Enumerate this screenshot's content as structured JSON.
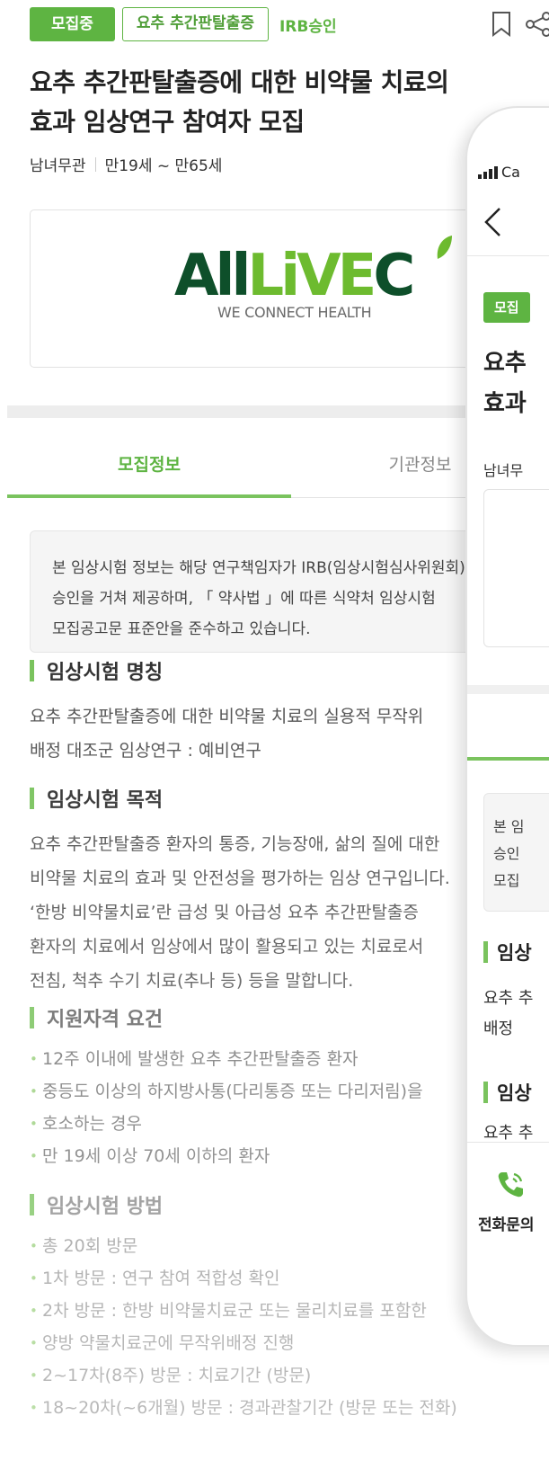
{
  "header": {
    "status_badge": "모집중",
    "category_badge": "요추 추간판탈출증",
    "irb_badge": "IRB승인",
    "title_line1": "요추 추간판탈출증에 대한 비약물 치료의",
    "title_line2": "효과 임상연구 참여자 모집",
    "gender": "남녀무관",
    "age_range": "만19세 ~ 만65세"
  },
  "logo": {
    "part1": "All",
    "part2": "LiVE",
    "part3": "C",
    "tagline": "WE CONNECT HEALTH"
  },
  "tabs": [
    {
      "label": "모집정보",
      "active": true
    },
    {
      "label": "기관정보",
      "active": false
    }
  ],
  "notice": {
    "line1": "본 임상시험 정보는 해당 연구책임자가 IRB(임상시험심사위원회)",
    "line2": "승인을 거쳐 제공하며, 「 약사법 」에 따른 식약처 임상시험",
    "line3": "모집공고문 표준안을 준수하고 있습니다."
  },
  "sections": {
    "name": {
      "heading": "임상시험 명칭",
      "line1": "요추 추간판탈출증에 대한 비약물 치료의 실용적 무작위",
      "line2": "배정 대조군 임상연구 : 예비연구"
    },
    "purpose": {
      "heading": "임상시험 목적",
      "line1": "요추 추간판탈출증 환자의 통증, 기능장애, 삶의 질에 대한",
      "line2": "비약물 치료의 효과 및 안전성을 평가하는 임상 연구입니다.",
      "line3": "‘한방 비약물치료’란 급성 및 아급성 요추 추간판탈출증",
      "line4": "환자의 치료에서 임상에서 많이 활용되고 있는 치료로서",
      "line5": "전침, 척추 수기 치료(추나 등) 등을 말합니다."
    },
    "eligibility": {
      "heading": "지원자격 요건",
      "items": [
        "12주 이내에 발생한 요추 추간판탈출증 환자",
        "중등도 이상의 하지방사통(다리통증 또는 다리저림)을",
        "만 19세 이상 70세 이하의 환자"
      ],
      "item2_cont": "호소하는 경우"
    },
    "method": {
      "heading": "임상시험 방법",
      "items": [
        "총 20회 방문",
        "1차 방문 : 연구 참여 적합성 확인",
        "2차 방문 : 한방 비약물치료군 또는 물리치료를 포함한",
        "2~17차(8주) 방문 : 치료기간 (방문)",
        "18~20차(~6개월) 방문 : 경과관찰기간 (방문 또는 전화)"
      ],
      "item3_cont": "양방 약물치료군에 무작위배정 진행"
    }
  },
  "phone": {
    "carrier": "Ca",
    "badge": "모집",
    "title_line1": "요추",
    "title_line2": "효과",
    "meta": "남녀무",
    "notice_line1": "본 임",
    "notice_line2": "승인",
    "notice_line3": "모집",
    "sec1": "임상",
    "body1_line1": "요추 추",
    "body1_line2": "배정",
    "sec2": "임상",
    "body2_line1": "요추 추",
    "call_label": "전화문의"
  },
  "colors": {
    "accent": "#5eb442",
    "accent_light": "#7ac35e",
    "logo_dark": "#0e4f2a",
    "logo_light": "#6dbb2f"
  }
}
